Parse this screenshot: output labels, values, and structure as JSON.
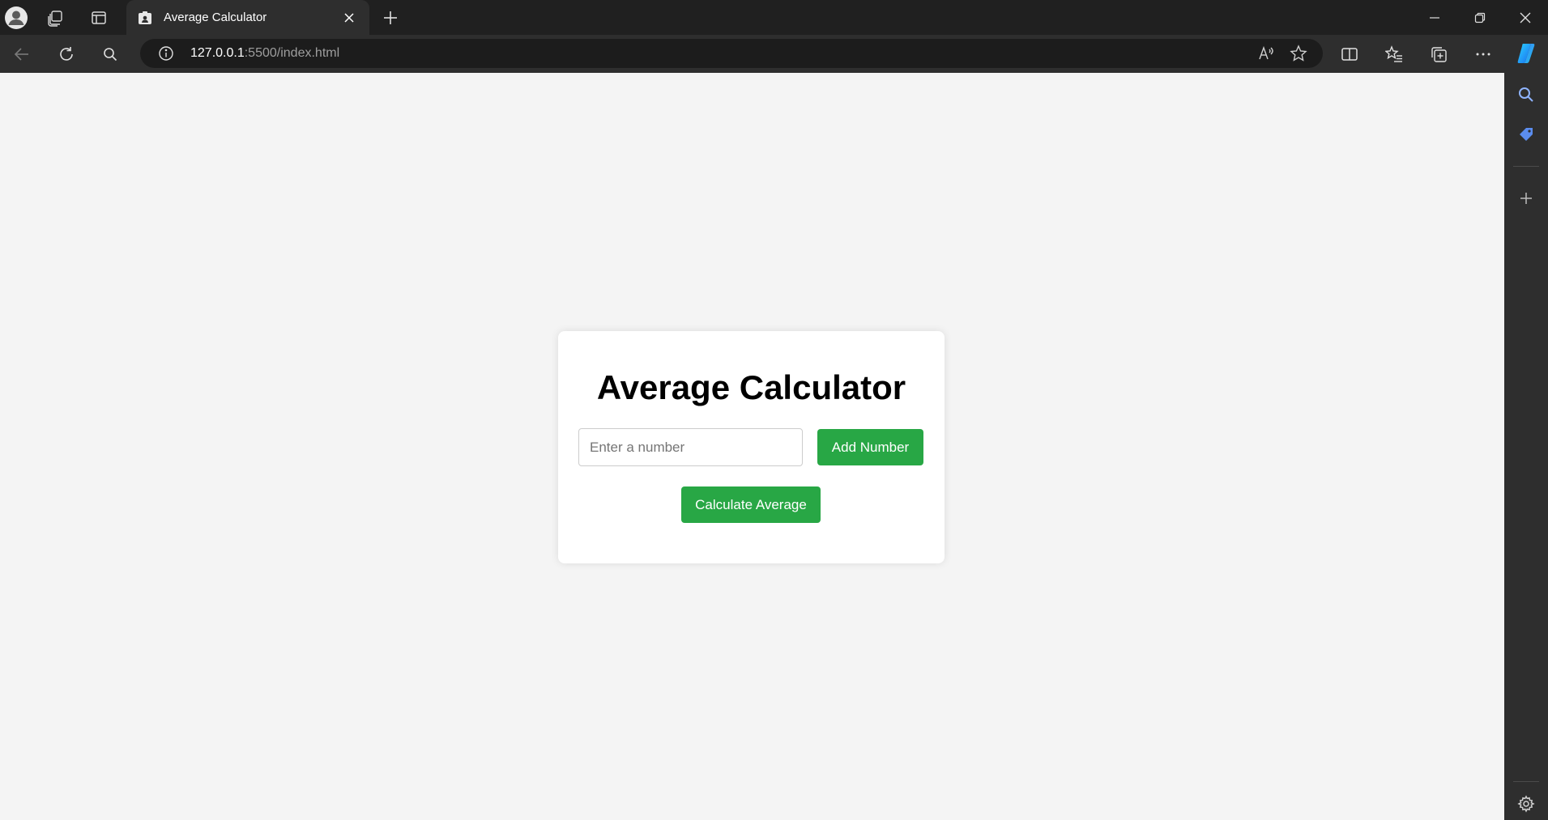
{
  "browser": {
    "tab": {
      "title": "Average Calculator"
    },
    "address": {
      "host": "127.0.0.1",
      "rest": ":5500/index.html"
    },
    "icons": {
      "profile": "profile-avatar-icon",
      "workspaces": "workspaces-icon",
      "tab_actions": "vertical-tabs-icon",
      "favicon": "favicon-icon",
      "tab_close": "close-icon",
      "new_tab": "plus-icon",
      "minimize": "minimize-icon",
      "restore": "restore-icon",
      "close_window": "close-icon",
      "back": "back-arrow-icon",
      "refresh": "refresh-icon",
      "search": "search-icon",
      "site_info": "info-icon",
      "read_aloud": "read-aloud-icon",
      "favorite": "star-icon",
      "split_screen": "split-screen-icon",
      "favorites": "favorites-list-icon",
      "collections": "collections-icon",
      "more": "more-icon",
      "copilot": "copilot-icon"
    },
    "sidebar": {
      "icons": [
        "search-icon",
        "tag-icon",
        "add-icon",
        "settings-icon"
      ]
    }
  },
  "page": {
    "heading": "Average Calculator",
    "input": {
      "value": "",
      "placeholder": "Enter a number"
    },
    "add_button": "Add Number",
    "calc_button": "Calculate Average"
  },
  "colors": {
    "button_green": "#28a745",
    "page_background": "#f4f4f4",
    "card_background": "#ffffff",
    "browser_chrome": "#2e2e2e"
  }
}
